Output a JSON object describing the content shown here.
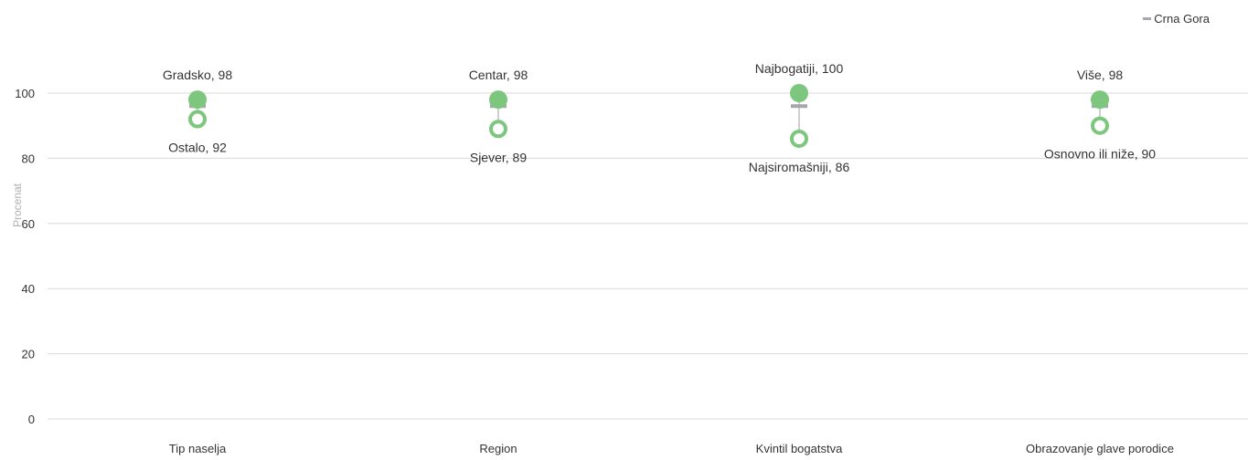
{
  "chart_data": {
    "type": "scatter",
    "ylabel": "Procenat",
    "ylim": [
      0,
      100
    ],
    "yticks": [
      0,
      20,
      40,
      60,
      80,
      100
    ],
    "grid": true,
    "legend": {
      "placement": "top-right",
      "label": "Crna Gora"
    },
    "colors": {
      "marker": "#7dc67e",
      "reference": "#a6a6ae",
      "connector": "#bfbfbf",
      "grid": "#d9d9d9",
      "label": "#333333",
      "axis_label": "#b0b0b0"
    },
    "reference_value": 96,
    "categories": [
      "Tip naselja",
      "Region",
      "Kvintil bogatstva",
      "Obrazovanje glave porodice"
    ],
    "high": [
      {
        "label": "Gradsko",
        "value": 98,
        "text": "Gradsko, 98"
      },
      {
        "label": "Centar",
        "value": 98,
        "text": "Centar, 98"
      },
      {
        "label": "Najbogatiji",
        "value": 100,
        "text": "Najbogatiji, 100"
      },
      {
        "label": "Više",
        "value": 98,
        "text": "Više, 98"
      }
    ],
    "low": [
      {
        "label": "Ostalo",
        "value": 92,
        "text": "Ostalo, 92"
      },
      {
        "label": "Sjever",
        "value": 89,
        "text": "Sjever, 89"
      },
      {
        "label": "Najsiromašniji",
        "value": 86,
        "text": "Najsiromašniji, 86"
      },
      {
        "label": "Osnovno ili niže",
        "value": 90,
        "text": "Osnovno ili niže, 90"
      }
    ]
  }
}
